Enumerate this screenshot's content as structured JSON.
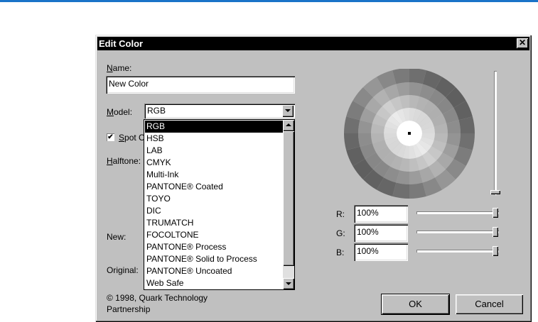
{
  "dialog": {
    "title": "Edit Color",
    "close_glyph": "✕"
  },
  "name": {
    "label": "Name:",
    "value": "New Color"
  },
  "model": {
    "label": "Model:",
    "selected": "RGB",
    "options": [
      "RGB",
      "HSB",
      "LAB",
      "CMYK",
      "Multi-Ink",
      "PANTONE® Coated",
      "TOYO",
      "DIC",
      "TRUMATCH",
      "FOCOLTONE",
      "PANTONE® Process",
      "PANTONE® Solid to Process",
      "PANTONE® Uncoated",
      "Web Safe"
    ]
  },
  "spot_color": {
    "label_visible": "Spot C",
    "checked": true,
    "check_glyph": "✔"
  },
  "halftone": {
    "label_visible": "Halftone:"
  },
  "swatch": {
    "new_label": "New:",
    "original_label": "Original:"
  },
  "copyright": {
    "line1": "© 1998, Quark Technology",
    "line2": "Partnership"
  },
  "rgb": {
    "r_label": "R:",
    "r_value": "100%",
    "g_label": "G:",
    "g_value": "100%",
    "b_label": "B:",
    "b_value": "100%"
  },
  "buttons": {
    "ok": "OK",
    "cancel": "Cancel"
  },
  "colors": {
    "title_bar": "#000000",
    "dialog_bg": "#c0c0c0",
    "selection": "#000000",
    "top_accent": "#1a73c8"
  }
}
